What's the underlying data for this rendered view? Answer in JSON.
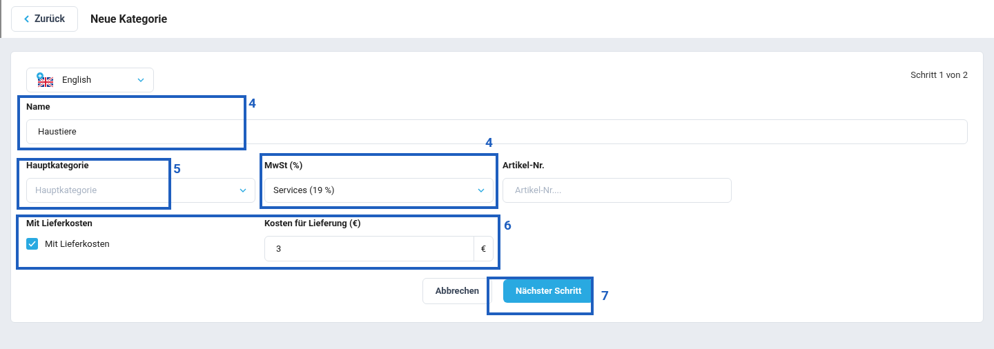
{
  "header": {
    "back_button": "Zurück",
    "title": "Neue Kategorie"
  },
  "form": {
    "language": {
      "value": "English"
    },
    "step": "Schritt 1 von 2",
    "name": {
      "label": "Name",
      "value": "Haustiere"
    },
    "main_category": {
      "label": "Hauptkategorie",
      "placeholder": "Hauptkategorie"
    },
    "vat": {
      "label": "MwSt (%)",
      "value": "Services (19 %)"
    },
    "article_number": {
      "label": "Artikel-Nr.",
      "placeholder": "Artikel-Nr...."
    },
    "delivery": {
      "label": "Mit Lieferkosten",
      "checkbox_label": "Mit Lieferkosten",
      "checked": true
    },
    "delivery_cost": {
      "label": "Kosten für Lieferung (€)",
      "value": "3",
      "unit": "€"
    },
    "buttons": {
      "cancel": "Abbrechen",
      "next": "Nächster Schritt"
    }
  },
  "annotations": [
    {
      "number": "4"
    },
    {
      "number": "5"
    },
    {
      "number": "4"
    },
    {
      "number": "6"
    },
    {
      "number": "7"
    }
  ]
}
